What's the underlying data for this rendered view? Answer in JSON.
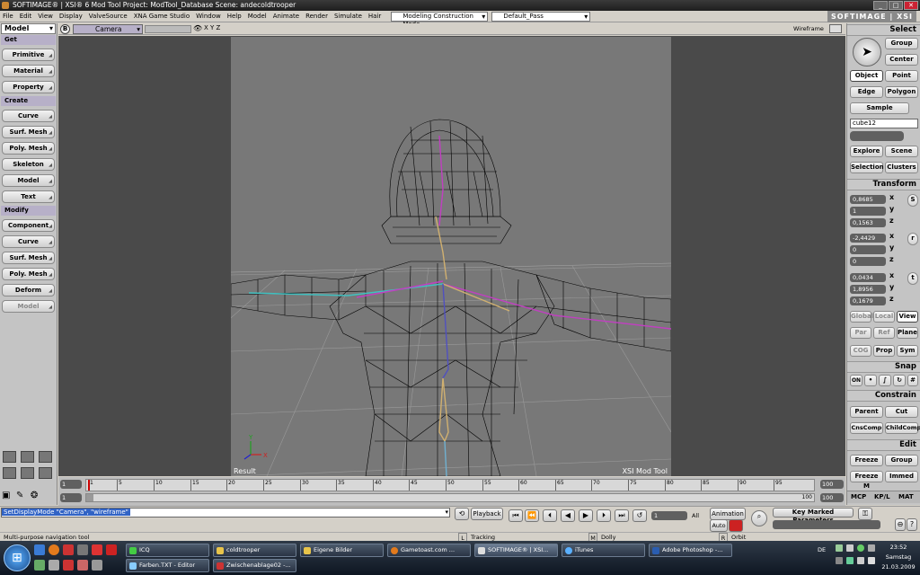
{
  "window": {
    "title": "SOFTIMAGE® | XSI® 6 Mod Tool Project: ModTool_Database   Scene: andecoldtrooper",
    "brand": "SOFTIMAGE | XSI"
  },
  "menu": {
    "items": [
      "File",
      "Edit",
      "View",
      "Display",
      "ValveSource",
      "XNA Game Studio",
      "Window",
      "Help",
      "Model",
      "Animate",
      "Render",
      "Simulate",
      "Hair"
    ],
    "construction_mode": "Modeling Construction Mode",
    "pass": "Default_Pass"
  },
  "left_panel": {
    "mode": "Model",
    "sections": [
      {
        "title": "Get",
        "buttons": [
          "Primitive",
          "Material",
          "Property"
        ]
      },
      {
        "title": "Create",
        "buttons": [
          "Curve",
          "Surf. Mesh",
          "Poly. Mesh",
          "Skeleton",
          "Model",
          "Text"
        ]
      },
      {
        "title": "Modify",
        "buttons": [
          "Component",
          "Curve",
          "Surf. Mesh",
          "Poly. Mesh",
          "Deform",
          "Model"
        ]
      }
    ]
  },
  "viewport": {
    "camera": "Camera",
    "display_mode": "Wireframe",
    "axes": "X Y Z",
    "result_label": "Result",
    "watermark": "XSI  Mod  Tool",
    "axis_x": "X",
    "axis_y": "Y"
  },
  "right_panel": {
    "select_title": "Select",
    "group": "Group",
    "center": "Center",
    "object": "Object",
    "point": "Point",
    "edge": "Edge",
    "polygon": "Polygon",
    "sample": "Sample",
    "selection_name": "cube12",
    "explore": "Explore",
    "scene": "Scene",
    "selection": "Selection",
    "clusters": "Clusters",
    "transform_title": "Transform",
    "scale": {
      "x": "0,8685",
      "y": "1",
      "z": "0,1563",
      "key": "S"
    },
    "rotate": {
      "x": "-2,4429",
      "y": "0",
      "z": "0",
      "key": "r"
    },
    "translate": {
      "x": "0,0434",
      "y": "1,8956",
      "z": "0,1679",
      "key": "t"
    },
    "ref_global": "Global",
    "ref_local": "Local",
    "ref_view": "View",
    "ref_par": "Par",
    "ref_ref": "Ref",
    "ref_plane": "Plane",
    "cog": "COG",
    "prop": "Prop",
    "sym": "Sym",
    "snap_title": "Snap",
    "snap_on": "ON",
    "constrain_title": "Constrain",
    "parent": "Parent",
    "cut": "Cut",
    "cnscomp": "CnsComp",
    "childcomp": "ChildComp",
    "edit_title": "Edit",
    "freeze": "Freeze",
    "group2": "Group",
    "freeze_m": "Freeze M",
    "immed": "Immed",
    "tab_mcp": "MCP",
    "tab_kpl": "KP/L",
    "tab_mat": "MAT"
  },
  "timeline": {
    "start": "1",
    "start2": "1",
    "end": "100",
    "end2": "100",
    "end_small": "100",
    "ticks": [
      "1",
      "5",
      "10",
      "15",
      "20",
      "25",
      "30",
      "35",
      "40",
      "45",
      "50",
      "55",
      "60",
      "65",
      "70",
      "75",
      "80",
      "85",
      "90",
      "95"
    ]
  },
  "lower_bar": {
    "script_command": "SetDisplayMode \"Camera\", \"wireframe\"",
    "playback": "Playback",
    "frame": "1",
    "all": "All",
    "animation": "Animation",
    "auto": "Auto",
    "key_marked": "Key Marked Parameters"
  },
  "status": {
    "message": "Multi-purpose navigation tool",
    "l_key": "L",
    "l_text": "Tracking",
    "m_key": "M",
    "m_text": "Dolly",
    "r_key": "R",
    "r_text": "Orbit"
  },
  "taskbar": {
    "items_row1": [
      "ICQ",
      "coldtrooper",
      "Eigene Bilder",
      "Gametoast.com ...",
      "SOFTIMAGE® | XSI...",
      "iTunes",
      "Adobe Photoshop -..."
    ],
    "items_row2": [
      "Farben.TXT - Editor",
      "Zwischenablage02 -..."
    ],
    "lang": "DE",
    "time": "23:52",
    "day": "Samstag",
    "date": "21.03.2009"
  },
  "colors": {
    "viewport_bg": "#4a4a4a",
    "viewport_inner": "#787878",
    "panel": "#c4c4c4",
    "section_head": "#b7b0c8",
    "taskbar": "#1e2836"
  }
}
